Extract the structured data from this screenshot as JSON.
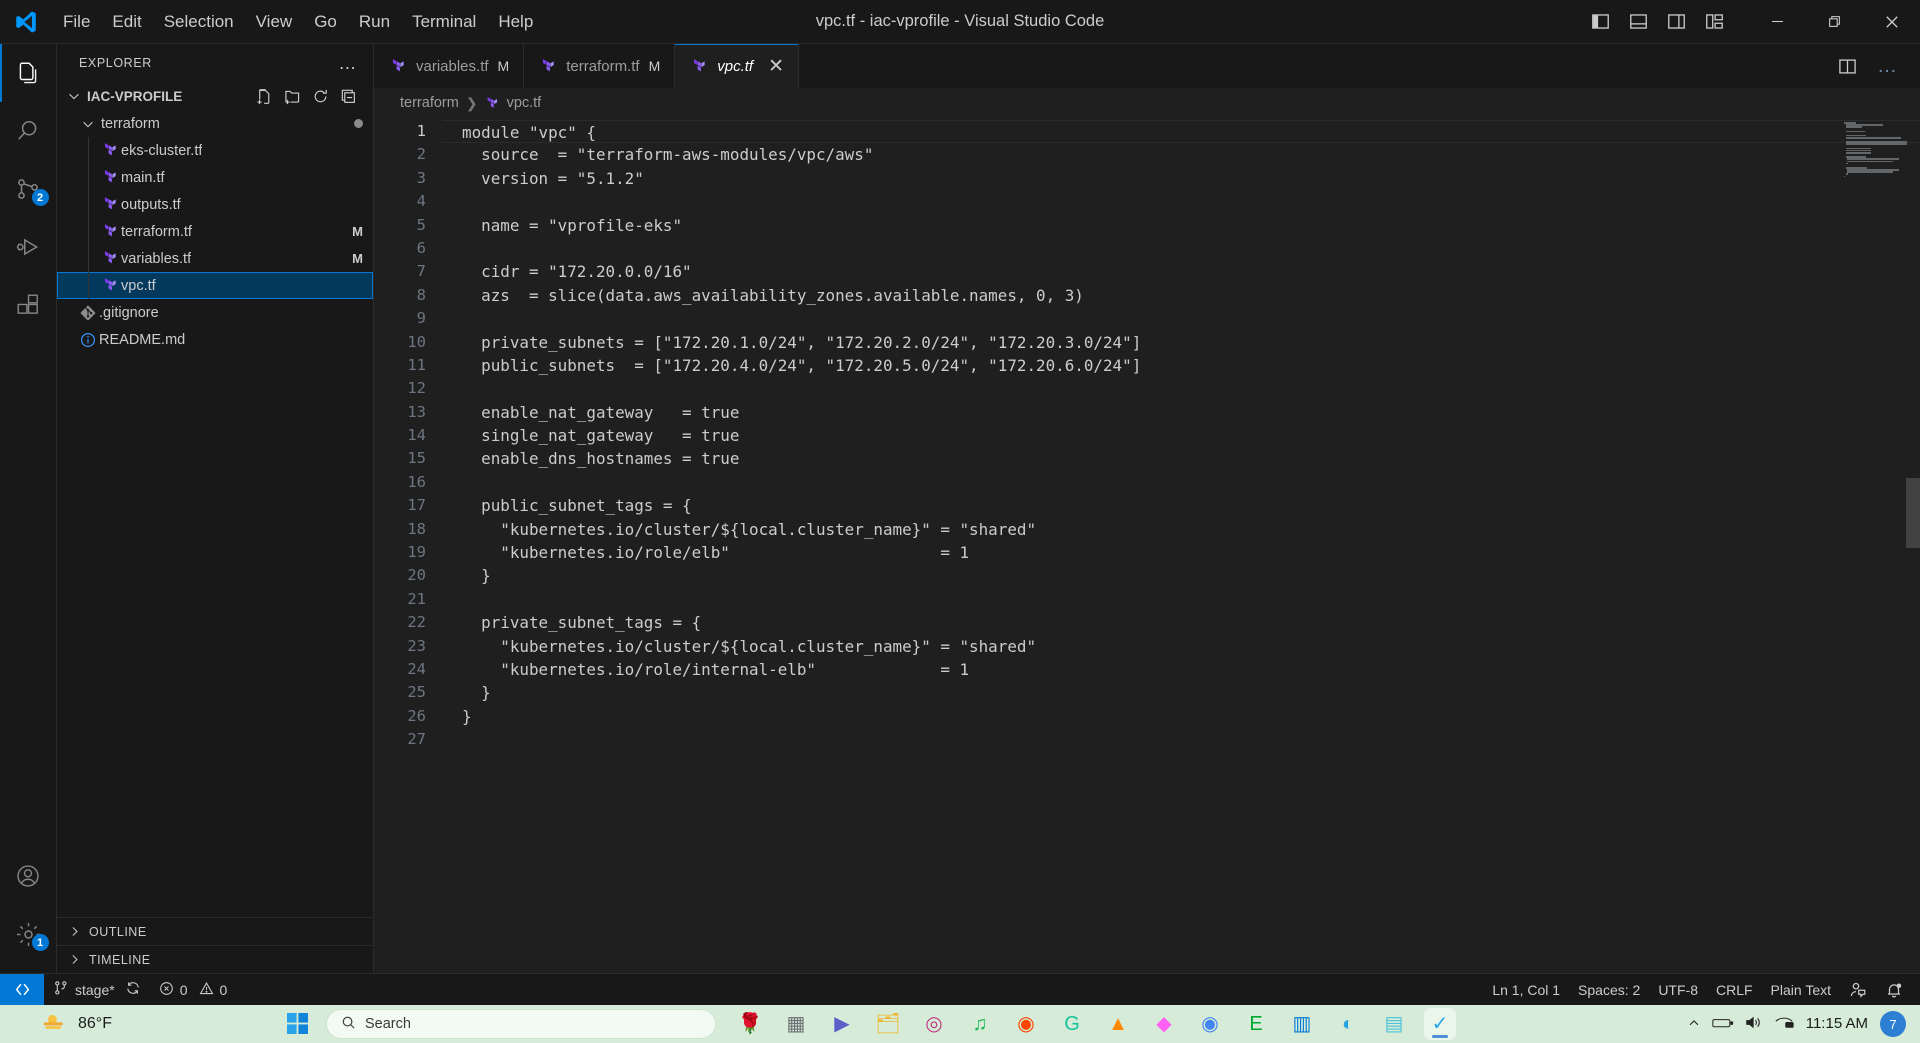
{
  "titlebar": {
    "window_title": "vpc.tf - iac-vprofile - Visual Studio Code",
    "menus": [
      "File",
      "Edit",
      "Selection",
      "View",
      "Go",
      "Run",
      "Terminal",
      "Help"
    ],
    "layout_buttons": [
      "toggle-primary-sidebar",
      "toggle-panel",
      "toggle-secondary-sidebar",
      "customize-layout"
    ],
    "window_controls": [
      "minimize",
      "restore",
      "close"
    ]
  },
  "activitybar": {
    "items": [
      {
        "name": "explorer",
        "icon": "files-icon",
        "active": true,
        "badge": ""
      },
      {
        "name": "search",
        "icon": "search-icon",
        "active": false,
        "badge": ""
      },
      {
        "name": "source-control",
        "icon": "source-control-icon",
        "active": false,
        "badge": "2"
      },
      {
        "name": "run-and-debug",
        "icon": "debug-icon",
        "active": false,
        "badge": ""
      },
      {
        "name": "extensions",
        "icon": "extensions-icon",
        "active": false,
        "badge": ""
      }
    ],
    "bottom": [
      {
        "name": "accounts",
        "icon": "account-icon",
        "badge": ""
      },
      {
        "name": "manage",
        "icon": "gear-icon",
        "badge": "1"
      }
    ]
  },
  "sidebar": {
    "title": "EXPLORER",
    "more_actions": "…",
    "root": {
      "label": "IAC-VPROFILE",
      "expanded": true,
      "actions": [
        "new-file",
        "new-folder",
        "refresh-explorer",
        "collapse-folders"
      ]
    },
    "tree": [
      {
        "label": "terraform",
        "type": "folder",
        "depth": 1,
        "expanded": true,
        "icon": "chevron-down-icon",
        "badge": "",
        "dirty": true,
        "selected": false
      },
      {
        "label": "eks-cluster.tf",
        "type": "file",
        "depth": 2,
        "icon": "terraform-icon",
        "badge": "",
        "dirty": false,
        "selected": false
      },
      {
        "label": "main.tf",
        "type": "file",
        "depth": 2,
        "icon": "terraform-icon",
        "badge": "",
        "dirty": false,
        "selected": false
      },
      {
        "label": "outputs.tf",
        "type": "file",
        "depth": 2,
        "icon": "terraform-icon",
        "badge": "",
        "dirty": false,
        "selected": false
      },
      {
        "label": "terraform.tf",
        "type": "file",
        "depth": 2,
        "icon": "terraform-icon",
        "badge": "M",
        "dirty": false,
        "selected": false
      },
      {
        "label": "variables.tf",
        "type": "file",
        "depth": 2,
        "icon": "terraform-icon",
        "badge": "M",
        "dirty": false,
        "selected": false
      },
      {
        "label": "vpc.tf",
        "type": "file",
        "depth": 2,
        "icon": "terraform-icon",
        "badge": "",
        "dirty": false,
        "selected": true
      },
      {
        "label": ".gitignore",
        "type": "file",
        "depth": 1,
        "icon": "git-icon",
        "badge": "",
        "dirty": false,
        "selected": false
      },
      {
        "label": "README.md",
        "type": "file",
        "depth": 1,
        "icon": "info-icon",
        "badge": "",
        "dirty": false,
        "selected": false
      }
    ],
    "panels": [
      {
        "label": "OUTLINE",
        "icon": "chevron-right-icon"
      },
      {
        "label": "TIMELINE",
        "icon": "chevron-right-icon"
      }
    ]
  },
  "editor": {
    "tabs": [
      {
        "label": "variables.tf",
        "modified": "M",
        "active": false,
        "icon": "terraform-icon",
        "closable": false
      },
      {
        "label": "terraform.tf",
        "modified": "M",
        "active": false,
        "icon": "terraform-icon",
        "closable": false
      },
      {
        "label": "vpc.tf",
        "modified": "",
        "active": true,
        "icon": "terraform-icon",
        "closable": true
      }
    ],
    "tab_actions": [
      "split-editor-right",
      "more-actions"
    ],
    "breadcrumb": [
      "terraform",
      "vpc.tf"
    ],
    "lines": [
      {
        "n": 1,
        "text": "module \"vpc\" {"
      },
      {
        "n": 2,
        "text": "  source  = \"terraform-aws-modules/vpc/aws\""
      },
      {
        "n": 3,
        "text": "  version = \"5.1.2\""
      },
      {
        "n": 4,
        "text": ""
      },
      {
        "n": 5,
        "text": "  name = \"vprofile-eks\""
      },
      {
        "n": 6,
        "text": ""
      },
      {
        "n": 7,
        "text": "  cidr = \"172.20.0.0/16\""
      },
      {
        "n": 8,
        "text": "  azs  = slice(data.aws_availability_zones.available.names, 0, 3)"
      },
      {
        "n": 9,
        "text": ""
      },
      {
        "n": 10,
        "text": "  private_subnets = [\"172.20.1.0/24\", \"172.20.2.0/24\", \"172.20.3.0/24\"]"
      },
      {
        "n": 11,
        "text": "  public_subnets  = [\"172.20.4.0/24\", \"172.20.5.0/24\", \"172.20.6.0/24\"]"
      },
      {
        "n": 12,
        "text": ""
      },
      {
        "n": 13,
        "text": "  enable_nat_gateway   = true"
      },
      {
        "n": 14,
        "text": "  single_nat_gateway   = true"
      },
      {
        "n": 15,
        "text": "  enable_dns_hostnames = true"
      },
      {
        "n": 16,
        "text": ""
      },
      {
        "n": 17,
        "text": "  public_subnet_tags = {"
      },
      {
        "n": 18,
        "text": "    \"kubernetes.io/cluster/${local.cluster_name}\" = \"shared\""
      },
      {
        "n": 19,
        "text": "    \"kubernetes.io/role/elb\"                      = 1"
      },
      {
        "n": 20,
        "text": "  }"
      },
      {
        "n": 21,
        "text": ""
      },
      {
        "n": 22,
        "text": "  private_subnet_tags = {"
      },
      {
        "n": 23,
        "text": "    \"kubernetes.io/cluster/${local.cluster_name}\" = \"shared\""
      },
      {
        "n": 24,
        "text": "    \"kubernetes.io/role/internal-elb\"             = 1"
      },
      {
        "n": 25,
        "text": "  }"
      },
      {
        "n": 26,
        "text": "}"
      },
      {
        "n": 27,
        "text": ""
      }
    ]
  },
  "statusbar": {
    "remote_icon": "remote-window-icon",
    "branch": "stage*",
    "sync_icon": "sync-icon",
    "errors": "0",
    "warnings": "0",
    "cursor_position": "Ln 1, Col 1",
    "indentation": "Spaces: 2",
    "encoding": "UTF-8",
    "eol": "CRLF",
    "language": "Plain Text",
    "live_share_icon": "live-share-icon",
    "bell_icon": "bell-dot-icon"
  },
  "taskbar": {
    "weather_temp": "86°F",
    "weather_icon": "sun-cloud-icon",
    "start_icon": "windows-start-icon",
    "search_placeholder": "Search",
    "search_icon": "search-icon",
    "pinned": [
      {
        "name": "widgets-flowers",
        "glyph": "🌹",
        "color": "#e2453c",
        "active": false
      },
      {
        "name": "task-view",
        "glyph": "▦",
        "color": "#6b7075",
        "active": false
      },
      {
        "name": "zoom",
        "glyph": "▶",
        "color": "#5b5fc7",
        "active": false
      },
      {
        "name": "file-explorer",
        "glyph": "🗂",
        "color": "#f0b429",
        "active": false
      },
      {
        "name": "instagram",
        "glyph": "◎",
        "color": "#c13584",
        "active": false
      },
      {
        "name": "spotify",
        "glyph": "♫",
        "color": "#1db954",
        "active": false
      },
      {
        "name": "reddit",
        "glyph": "◉",
        "color": "#ff4500",
        "active": false
      },
      {
        "name": "grammarly",
        "glyph": "G",
        "color": "#15c39a",
        "active": false
      },
      {
        "name": "vlc",
        "glyph": "▲",
        "color": "#ff8800",
        "active": false
      },
      {
        "name": "adobe-xd",
        "glyph": "◆",
        "color": "#ff61f6",
        "active": false
      },
      {
        "name": "google-chrome",
        "glyph": "◉",
        "color": "#4285f4",
        "active": false
      },
      {
        "name": "evernote",
        "glyph": "E",
        "color": "#00a82d",
        "active": false
      },
      {
        "name": "microsoft-store",
        "glyph": "▥",
        "color": "#0078d4",
        "active": false
      },
      {
        "name": "microsoft-edge",
        "glyph": "◐",
        "color": "#27a2e3",
        "active": false
      },
      {
        "name": "notepad",
        "glyph": "▤",
        "color": "#4fc3d9",
        "active": false
      },
      {
        "name": "visual-studio-code",
        "glyph": "✓",
        "color": "#29a8ea",
        "active": true
      }
    ],
    "tray": [
      "show-hidden-icons",
      "battery-icon",
      "volume-icon",
      "network-icon"
    ],
    "clock_time": "11:15 AM",
    "notification_badge": "7"
  }
}
